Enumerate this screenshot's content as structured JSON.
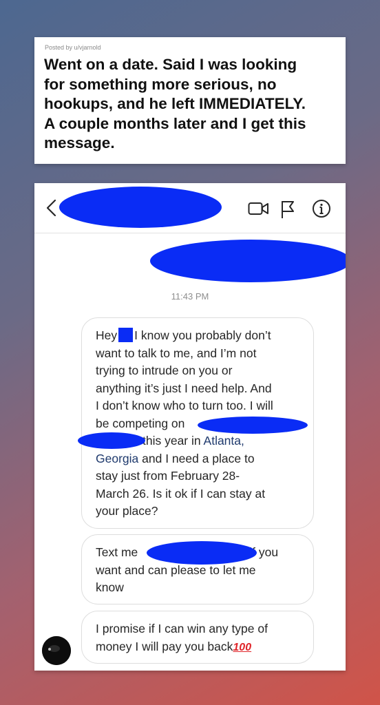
{
  "post": {
    "meta": "Posted by u/vjarnold",
    "title_lines": [
      "Went on a date. Said I was looking",
      "for something more serious, no",
      "hookups, and he left IMMEDIATELY.",
      "A couple months later and I get this",
      "message."
    ]
  },
  "chat": {
    "timestamp": "11:43 PM",
    "messages": [
      {
        "lines": [
          {
            "a": "Hey",
            "b": "I know you probably don’t"
          },
          {
            "a": "want to talk to me, and I’m not"
          },
          {
            "a": "trying to intrude on you or"
          },
          {
            "a": "anything it’s just I need help. And"
          },
          {
            "a": "I don’t know who to turn too. I will"
          },
          {
            "a": "be competing on"
          },
          {
            "a": "this year in",
            "link": "Atlanta,"
          },
          {
            "link": "Georgia",
            "a": "and I need a place to"
          },
          {
            "a": "stay just from February 28-"
          },
          {
            "a": "March 26. Is it ok if I can stay at"
          },
          {
            "a": "your place?"
          }
        ]
      },
      {
        "lines": [
          {
            "a": "Text me",
            "b": "if you"
          },
          {
            "a": "want and can please to let me"
          },
          {
            "a": "know"
          }
        ]
      },
      {
        "lines": [
          {
            "a": "I promise if I can win any type of"
          },
          {
            "a": "money I will pay you back",
            "emoji": "100"
          }
        ]
      }
    ]
  },
  "icons": {
    "back": "chevron-left-icon",
    "video": "video-camera-icon",
    "flag": "flag-icon",
    "info": "info-icon",
    "emoji": "hundred-points-emoji-icon"
  },
  "colors": {
    "redaction": "#0a2cf5",
    "link": "#1f3a6d",
    "emoji": "#e0262b"
  }
}
